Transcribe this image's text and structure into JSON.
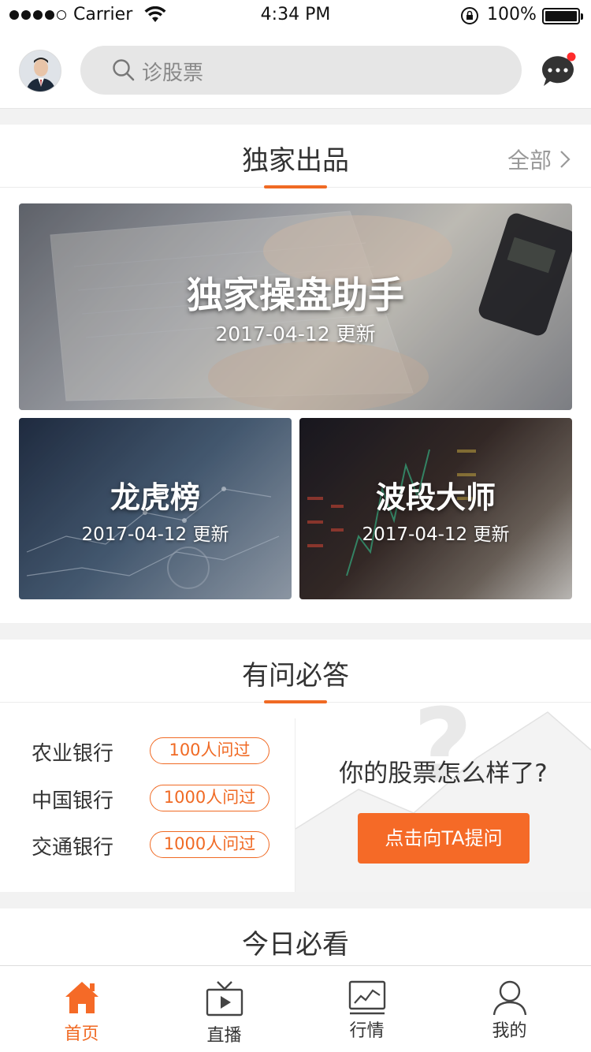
{
  "status_bar": {
    "carrier": "Carrier",
    "time": "4:34 PM",
    "battery": "100%"
  },
  "header": {
    "search_placeholder": "诊股票",
    "avatar_icon": "user-avatar",
    "message_icon": "chat-bubble-icon",
    "has_unread": true
  },
  "exclusive": {
    "title": "独家出品",
    "more_label": "全部",
    "cards": [
      {
        "title": "独家操盘助手",
        "date": "2017-04-12  更新"
      },
      {
        "title": "龙虎榜",
        "date": "2017-04-12  更新"
      },
      {
        "title": "波段大师",
        "date": "2017-04-12  更新"
      }
    ]
  },
  "qa": {
    "title": "有问必答",
    "items": [
      {
        "name": "农业银行",
        "count": "100人问过"
      },
      {
        "name": "中国银行",
        "count": "1000人问过"
      },
      {
        "name": "交通银行",
        "count": "1000人问过"
      }
    ],
    "question": "你的股票怎么样了?",
    "ask_button": "点击向TA提问"
  },
  "today": {
    "title": "今日必看"
  },
  "tabbar": {
    "tabs": [
      {
        "label": "首页",
        "icon": "home-icon",
        "active": true
      },
      {
        "label": "直播",
        "icon": "tv-play-icon",
        "active": false
      },
      {
        "label": "行情",
        "icon": "market-chart-icon",
        "active": false
      },
      {
        "label": "我的",
        "icon": "profile-icon",
        "active": false
      }
    ]
  },
  "colors": {
    "accent": "#f06a24",
    "button": "#f56a27",
    "unread_dot": "#ff2b2b"
  }
}
